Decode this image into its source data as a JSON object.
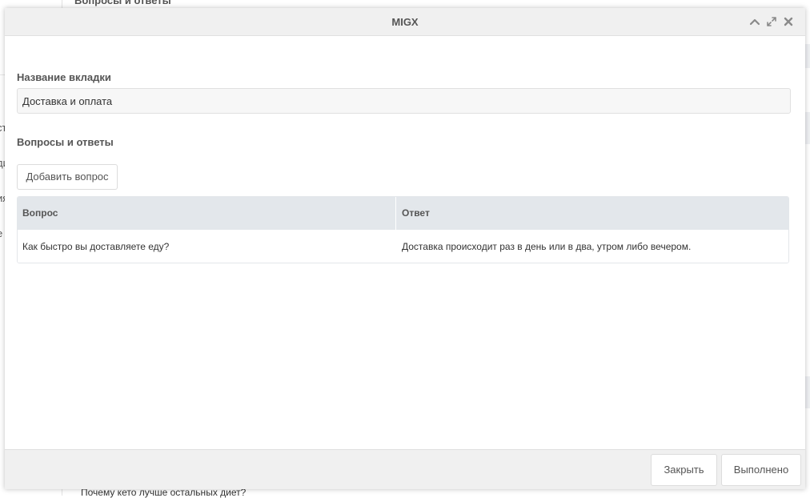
{
  "background": {
    "top_title": "Вопросы и ответы",
    "bottom_text": "Почему кето лучше остальных диет?",
    "left_items": [
      "ст",
      "ди",
      "ия",
      "е"
    ]
  },
  "modal": {
    "title": "MIGX",
    "tools": {
      "collapse_icon": "chevron-up-icon",
      "maximize_icon": "expand-icon",
      "close_icon": "close-icon"
    },
    "tab_name": {
      "label": "Название вкладки",
      "value": "Доставка и оплата"
    },
    "qa": {
      "label": "Вопросы и ответы",
      "add_button": "Добавить вопрос",
      "columns": [
        "Вопрос",
        "Ответ"
      ],
      "rows": [
        {
          "question": "Как быстро вы доставляете еду?",
          "answer": "Доставка происходит раз в день или в два, утром либо вечером."
        }
      ]
    },
    "footer": {
      "close_label": "Закрыть",
      "done_label": "Выполнено"
    }
  },
  "colors": {
    "header_bg": "#f0f0f0",
    "grid_header_bg": "#e3e7eb",
    "text": "#555555"
  }
}
